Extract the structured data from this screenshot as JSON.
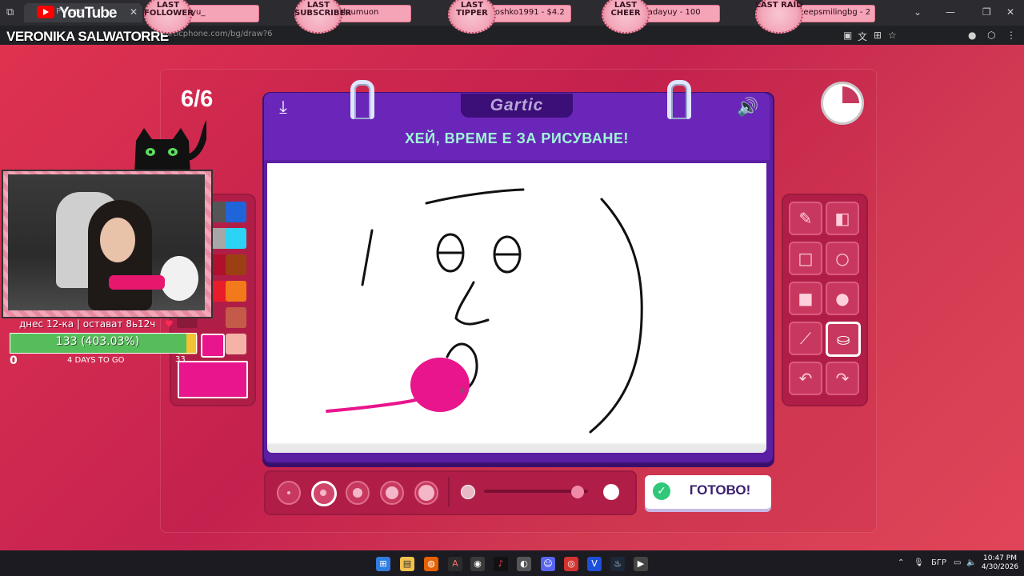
{
  "browser": {
    "tab_title": "Р теле",
    "url": "garticphone.com/bg/draw?6",
    "youtube_word": "YouTube"
  },
  "channel": {
    "name": "VERONIKA SALWATORRE"
  },
  "events": [
    {
      "label": "LAST FOLLOWER",
      "value": "ryu_"
    },
    {
      "label": "LAST SUBSCRIBER",
      "value": "bluumuon"
    },
    {
      "label": "LAST TIPPER",
      "value": "roshko1991 - $4.2"
    },
    {
      "label": "LAST CHEER",
      "value": "jadayuy - 100"
    },
    {
      "label": "LAST RAID",
      "value": "keepsmilingbg - 2"
    }
  ],
  "game": {
    "round": "6/6",
    "logo": "Gartic",
    "title": "ХЕЙ, ВРЕМЕ Е ЗА РИСУВАНЕ!",
    "timer_elapsed_fraction": 0.25,
    "brush_size_value": "33",
    "done_label": "ГОТОВО!",
    "selected_color": "#e8158c",
    "palette": [
      "#555555",
      "#1f64d8",
      "#a7a7a7",
      "#2bd3f5",
      "#b0102c",
      "#9c3f12",
      "#e81c2a",
      "#f27a1b",
      "#8a1a3a",
      "#c35a4a",
      "#d0912c",
      "#e8158c",
      "#f5b3a8"
    ],
    "selected_size_index": 1,
    "opacity_fraction": 0.9
  },
  "tools": [
    {
      "name": "pencil-icon",
      "glyph": "✎"
    },
    {
      "name": "eraser-icon",
      "glyph": "◧"
    },
    {
      "name": "rectangle-outline-icon",
      "glyph": "□"
    },
    {
      "name": "ellipse-outline-icon",
      "glyph": "○"
    },
    {
      "name": "rectangle-fill-icon",
      "glyph": "■"
    },
    {
      "name": "ellipse-fill-icon",
      "glyph": "●"
    },
    {
      "name": "line-icon",
      "glyph": "⟋"
    },
    {
      "name": "bucket-fill-icon",
      "glyph": "⛀"
    },
    {
      "name": "undo-icon",
      "glyph": "↶"
    },
    {
      "name": "redo-icon",
      "glyph": "↷"
    }
  ],
  "goal": {
    "caption": "днес 12-ка | остават 8ь12ч",
    "progress_text": "133 (403.03%)",
    "start": "0",
    "days": "4 DAYS TO GO"
  },
  "taskbar": {
    "lang": "БГР",
    "time": "10:47 PM",
    "date": "4/30/2026"
  }
}
